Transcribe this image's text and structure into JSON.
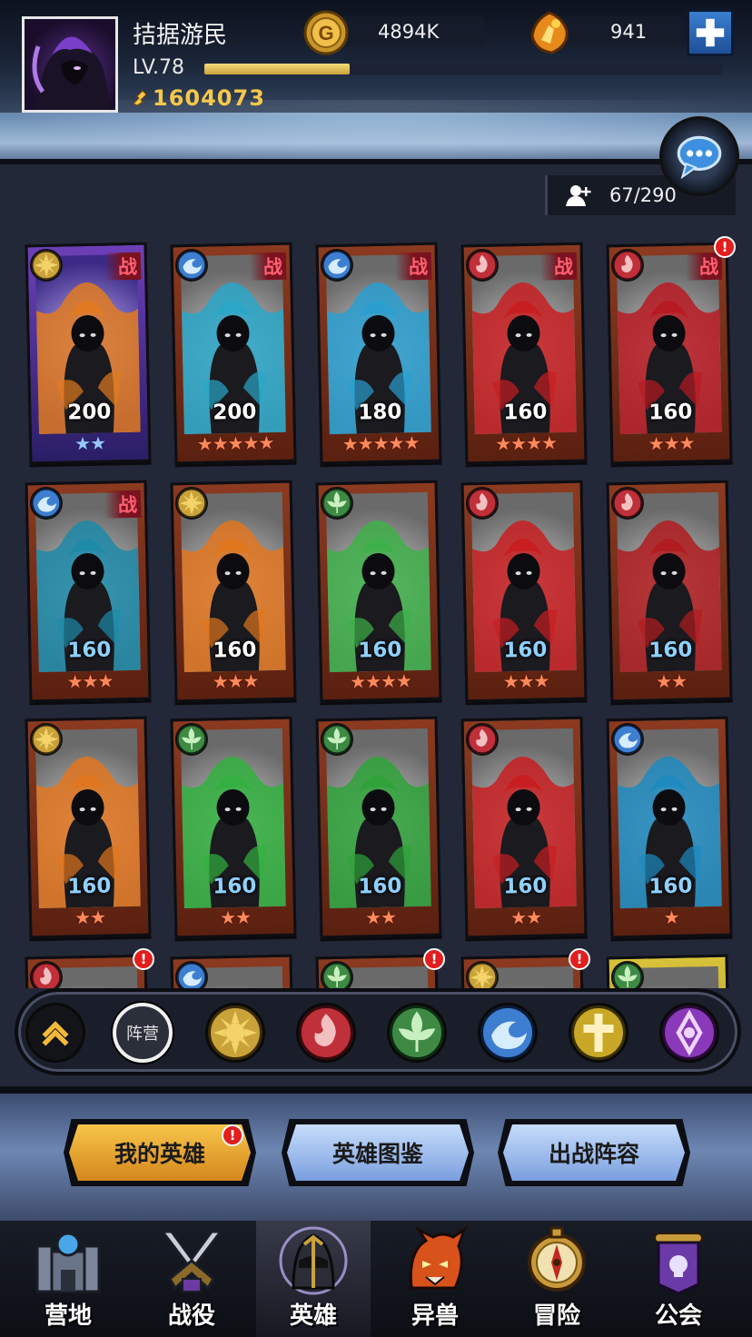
{
  "player": {
    "name": "拮据游民",
    "level": "LV.78",
    "xp_fraction": 0.28,
    "power": "1604073"
  },
  "resources": {
    "gold": "4894K",
    "gems": "941"
  },
  "roster": {
    "count": "67/290"
  },
  "colors": {
    "sun": "#c9a23a",
    "fire": "#c0303a",
    "leaf": "#3e8a44",
    "water": "#3d7ed0",
    "holy": "#c8a826",
    "void": "#8a3ab8",
    "star_orange": "#ff8a5c",
    "star_blue": "#9ac6ff",
    "accent_gold": "#f6c84a"
  },
  "heroes": [
    {
      "faction": "sun",
      "level": "200",
      "stars": 2,
      "star_color": "blue",
      "level_color": "white",
      "war": true,
      "alert": false,
      "frame": "purple",
      "theme": "#e07a20"
    },
    {
      "faction": "water",
      "level": "200",
      "stars": 5,
      "star_color": "orange",
      "level_color": "white",
      "war": true,
      "alert": false,
      "frame": "red",
      "theme": "#2aa6c8"
    },
    {
      "faction": "water",
      "level": "180",
      "stars": 5,
      "star_color": "orange",
      "level_color": "white",
      "war": true,
      "alert": false,
      "frame": "red",
      "theme": "#2a9fd0"
    },
    {
      "faction": "fire",
      "level": "160",
      "stars": 4,
      "star_color": "orange",
      "level_color": "white",
      "war": true,
      "alert": false,
      "frame": "red",
      "theme": "#c81e22"
    },
    {
      "faction": "fire",
      "level": "160",
      "stars": 3,
      "star_color": "orange",
      "level_color": "white",
      "war": true,
      "alert": true,
      "frame": "red",
      "theme": "#b81a22"
    },
    {
      "faction": "water",
      "level": "160",
      "stars": 3,
      "star_color": "orange",
      "level_color": "blue",
      "war": true,
      "alert": false,
      "frame": "red",
      "theme": "#1d8aa8"
    },
    {
      "faction": "sun",
      "level": "160",
      "stars": 3,
      "star_color": "orange",
      "level_color": "white",
      "war": false,
      "alert": false,
      "frame": "red",
      "theme": "#e0761e"
    },
    {
      "faction": "leaf",
      "level": "160",
      "stars": 4,
      "star_color": "orange",
      "level_color": "blue",
      "war": false,
      "alert": false,
      "frame": "red",
      "theme": "#3fb04a"
    },
    {
      "faction": "fire",
      "level": "160",
      "stars": 3,
      "star_color": "orange",
      "level_color": "blue",
      "war": false,
      "alert": false,
      "frame": "red",
      "theme": "#c81e22"
    },
    {
      "faction": "fire",
      "level": "160",
      "stars": 2,
      "star_color": "orange",
      "level_color": "blue",
      "war": false,
      "alert": false,
      "frame": "red",
      "theme": "#b01c20"
    },
    {
      "faction": "sun",
      "level": "160",
      "stars": 2,
      "star_color": "orange",
      "level_color": "blue",
      "war": false,
      "alert": false,
      "frame": "red",
      "theme": "#e0761e"
    },
    {
      "faction": "leaf",
      "level": "160",
      "stars": 2,
      "star_color": "orange",
      "level_color": "blue",
      "war": false,
      "alert": false,
      "frame": "red",
      "theme": "#33b040"
    },
    {
      "faction": "leaf",
      "level": "160",
      "stars": 2,
      "star_color": "orange",
      "level_color": "blue",
      "war": false,
      "alert": false,
      "frame": "red",
      "theme": "#2fa23a"
    },
    {
      "faction": "fire",
      "level": "160",
      "stars": 2,
      "star_color": "orange",
      "level_color": "blue",
      "war": false,
      "alert": false,
      "frame": "red",
      "theme": "#c81e22"
    },
    {
      "faction": "water",
      "level": "160",
      "stars": 1,
      "star_color": "orange",
      "level_color": "blue",
      "war": false,
      "alert": false,
      "frame": "red",
      "theme": "#1e8ac0"
    },
    {
      "faction": "fire",
      "level": "",
      "stars": 0,
      "star_color": "orange",
      "level_color": "white",
      "war": false,
      "alert": true,
      "frame": "red",
      "theme": "#c83a22"
    },
    {
      "faction": "water",
      "level": "",
      "stars": 0,
      "star_color": "orange",
      "level_color": "white",
      "war": false,
      "alert": false,
      "frame": "red",
      "theme": "#2a8ab0"
    },
    {
      "faction": "leaf",
      "level": "",
      "stars": 0,
      "star_color": "orange",
      "level_color": "white",
      "war": false,
      "alert": true,
      "frame": "red",
      "theme": "#3fa040"
    },
    {
      "faction": "sun",
      "level": "",
      "stars": 0,
      "star_color": "orange",
      "level_color": "white",
      "war": false,
      "alert": true,
      "frame": "red",
      "theme": "#e07a20"
    },
    {
      "faction": "leaf",
      "level": "",
      "stars": 0,
      "star_color": "orange",
      "level_color": "white",
      "war": false,
      "alert": false,
      "frame": "gold",
      "theme": "#3fa040"
    }
  ],
  "war_tag": "战",
  "alert_mark": "!",
  "filters": {
    "camp_label": "阵营",
    "factions": [
      "sun",
      "fire",
      "leaf",
      "water",
      "holy",
      "void"
    ]
  },
  "tabs": [
    {
      "label": "我的英雄",
      "active": true,
      "alert": true
    },
    {
      "label": "英雄图鉴",
      "active": false,
      "alert": false
    },
    {
      "label": "出战阵容",
      "active": false,
      "alert": false
    }
  ],
  "nav": [
    {
      "label": "营地",
      "icon": "camp-icon",
      "active": false
    },
    {
      "label": "战役",
      "icon": "battle-icon",
      "active": false
    },
    {
      "label": "英雄",
      "icon": "hero-icon",
      "active": true
    },
    {
      "label": "异兽",
      "icon": "beast-icon",
      "active": false
    },
    {
      "label": "冒险",
      "icon": "compass-icon",
      "active": false
    },
    {
      "label": "公会",
      "icon": "guild-icon",
      "active": false
    }
  ]
}
